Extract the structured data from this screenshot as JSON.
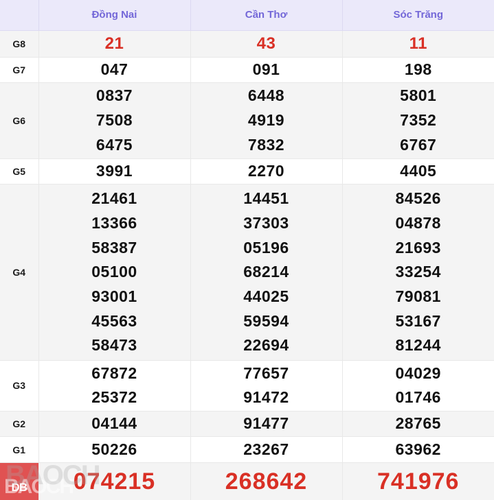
{
  "table": {
    "label_header": "",
    "columns": [
      "Đồng Nai",
      "Cần Thơ",
      "Sóc Trăng"
    ],
    "rows": [
      {
        "label": "G8",
        "style": "g8",
        "values": [
          [
            "21"
          ],
          [
            "43"
          ],
          [
            "11"
          ]
        ]
      },
      {
        "label": "G7",
        "style": "normal",
        "values": [
          [
            "047"
          ],
          [
            "091"
          ],
          [
            "198"
          ]
        ]
      },
      {
        "label": "G6",
        "style": "normal",
        "values": [
          [
            "0837",
            "7508",
            "6475"
          ],
          [
            "6448",
            "4919",
            "7832"
          ],
          [
            "5801",
            "7352",
            "6767"
          ]
        ]
      },
      {
        "label": "G5",
        "style": "normal",
        "values": [
          [
            "3991"
          ],
          [
            "2270"
          ],
          [
            "4405"
          ]
        ]
      },
      {
        "label": "G4",
        "style": "normal",
        "values": [
          [
            "21461",
            "13366",
            "58387",
            "05100",
            "93001",
            "45563",
            "58473"
          ],
          [
            "14451",
            "37303",
            "05196",
            "68214",
            "44025",
            "59594",
            "22694"
          ],
          [
            "84526",
            "04878",
            "21693",
            "33254",
            "79081",
            "53167",
            "81244"
          ]
        ]
      },
      {
        "label": "G3",
        "style": "normal",
        "values": [
          [
            "67872",
            "25372"
          ],
          [
            "77657",
            "91472"
          ],
          [
            "04029",
            "01746"
          ]
        ]
      },
      {
        "label": "G2",
        "style": "normal",
        "values": [
          [
            "04144"
          ],
          [
            "91477"
          ],
          [
            "28765"
          ]
        ]
      },
      {
        "label": "G1",
        "style": "normal",
        "values": [
          [
            "50226"
          ],
          [
            "23267"
          ],
          [
            "63962"
          ]
        ]
      }
    ],
    "special_row": {
      "badge_text": "DB",
      "values": [
        "074215",
        "268642",
        "741976"
      ]
    },
    "watermark_text": "BAOCH"
  },
  "colors": {
    "header_bg": "#ebe9fa",
    "header_text": "#7367d8",
    "highlight_red": "#d93025",
    "badge_bg": "#e05252",
    "row_alt_bg": "#f4f4f4"
  }
}
